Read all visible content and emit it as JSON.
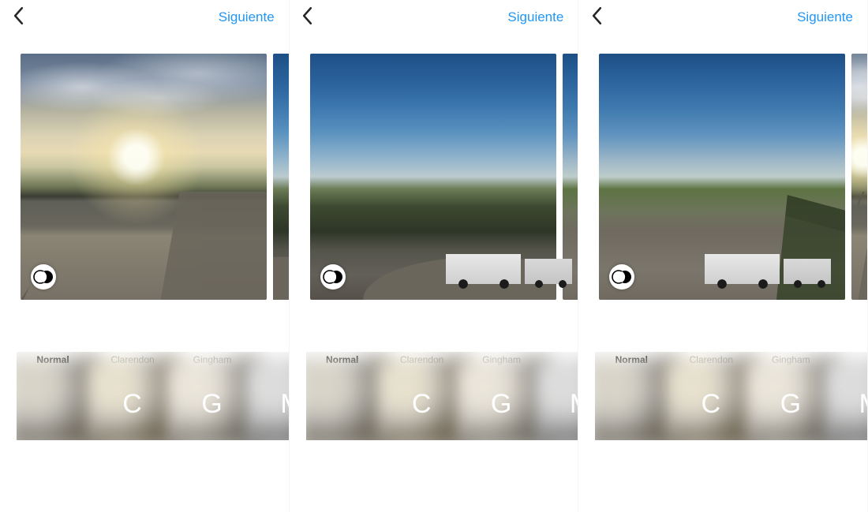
{
  "accent_color": "#2196f3",
  "panes": [
    {
      "next_label": "Siguiente",
      "photo": "sunset",
      "filters": [
        {
          "name": "Normal",
          "letter": "",
          "kind": "n",
          "selected": true
        },
        {
          "name": "Clarendon",
          "letter": "C",
          "kind": "c",
          "selected": false
        },
        {
          "name": "Gingham",
          "letter": "G",
          "kind": "g",
          "selected": false
        },
        {
          "name": "M",
          "letter": "M",
          "kind": "m",
          "selected": false
        }
      ]
    },
    {
      "next_label": "Siguiente",
      "photo": "valley",
      "filters": [
        {
          "name": "Normal",
          "letter": "",
          "kind": "n",
          "selected": true
        },
        {
          "name": "Clarendon",
          "letter": "C",
          "kind": "c",
          "selected": false
        },
        {
          "name": "Gingham",
          "letter": "G",
          "kind": "g",
          "selected": false
        },
        {
          "name": "M",
          "letter": "M",
          "kind": "m",
          "selected": false
        }
      ]
    },
    {
      "next_label": "Siguiente",
      "photo": "cars",
      "filters": [
        {
          "name": "Normal",
          "letter": "",
          "kind": "n",
          "selected": true
        },
        {
          "name": "Clarendon",
          "letter": "C",
          "kind": "c",
          "selected": false
        },
        {
          "name": "Gingham",
          "letter": "G",
          "kind": "g",
          "selected": false
        },
        {
          "name": "M",
          "letter": "M",
          "kind": "m",
          "selected": false
        }
      ]
    }
  ]
}
